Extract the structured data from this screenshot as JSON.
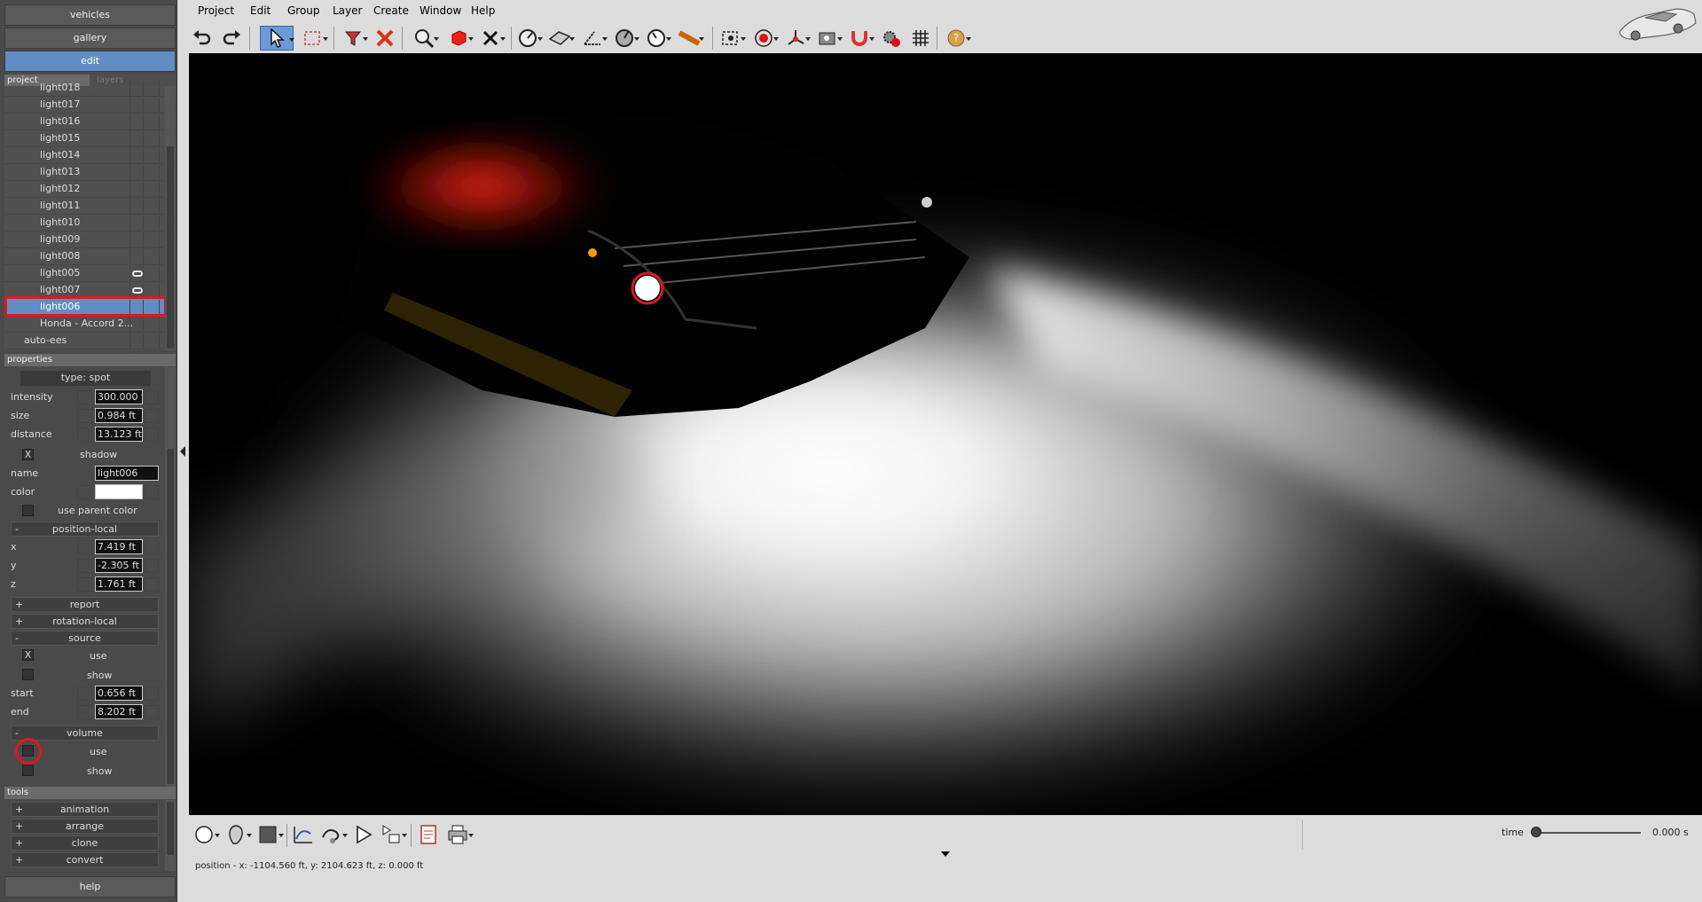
{
  "sidebar": {
    "vehicles_label": "vehicles",
    "gallery_label": "gallery",
    "edit_label": "edit",
    "tabs": {
      "project": "project",
      "layers": "layers"
    },
    "tree": [
      {
        "label": "light018",
        "linked": false,
        "selected": false
      },
      {
        "label": "light017",
        "linked": false,
        "selected": false
      },
      {
        "label": "light016",
        "linked": false,
        "selected": false
      },
      {
        "label": "light015",
        "linked": false,
        "selected": false
      },
      {
        "label": "light014",
        "linked": false,
        "selected": false
      },
      {
        "label": "light013",
        "linked": false,
        "selected": false
      },
      {
        "label": "light012",
        "linked": false,
        "selected": false
      },
      {
        "label": "light011",
        "linked": false,
        "selected": false
      },
      {
        "label": "light010",
        "linked": false,
        "selected": false
      },
      {
        "label": "light009",
        "linked": false,
        "selected": false
      },
      {
        "label": "light008",
        "linked": false,
        "selected": false
      },
      {
        "label": "light005",
        "linked": true,
        "selected": false
      },
      {
        "label": "light007",
        "linked": true,
        "selected": false
      },
      {
        "label": "light006",
        "linked": false,
        "selected": true
      },
      {
        "label": "Honda - Accord 2...",
        "linked": false,
        "selected": false
      },
      {
        "label": "auto-ees",
        "linked": false,
        "selected": false
      }
    ],
    "properties_label": "properties",
    "properties": {
      "type": "type: spot",
      "intensity_label": "intensity",
      "intensity": "300.000 %",
      "size_label": "size",
      "size": "0.984 ft",
      "distance_label": "distance",
      "distance": "13.123 ft",
      "shadow_label": "shadow",
      "shadow_checked": "X",
      "name_label": "name",
      "name": "light006",
      "color_label": "color",
      "use_parent_color_label": "use parent color",
      "position_local_label": "position-local",
      "x_label": "x",
      "x": "7.419 ft",
      "y_label": "y",
      "y": "-2.305 ft",
      "z_label": "z",
      "z": "1.761 ft",
      "report_label": "report",
      "rotation_local_label": "rotation-local",
      "source_label": "source",
      "source_use_label": "use",
      "source_use_checked": "X",
      "source_show_label": "show",
      "start_label": "start",
      "start": "0.656 ft",
      "end_label": "end",
      "end": "8.202 ft",
      "volume_label": "volume",
      "volume_use_label": "use",
      "volume_show_label": "show",
      "minus": "-",
      "plus": "+"
    },
    "tools_label": "tools",
    "tools": [
      {
        "sign": "+",
        "label": "animation"
      },
      {
        "sign": "+",
        "label": "arrange"
      },
      {
        "sign": "+",
        "label": "clone"
      },
      {
        "sign": "+",
        "label": "convert"
      }
    ],
    "help_label": "help"
  },
  "menubar": [
    "Project",
    "Edit",
    "Group",
    "Layer",
    "Create",
    "Window",
    "Help"
  ],
  "status": {
    "position": "position - x: -1104.560 ft, y: 2104.623 ft, z: 0.000 ft"
  },
  "timeline": {
    "label": "time",
    "value": "0.000 s",
    "fraction": 0.0
  },
  "colors": {
    "accent": "#5f8dc4",
    "highlight": "#e2161e"
  }
}
